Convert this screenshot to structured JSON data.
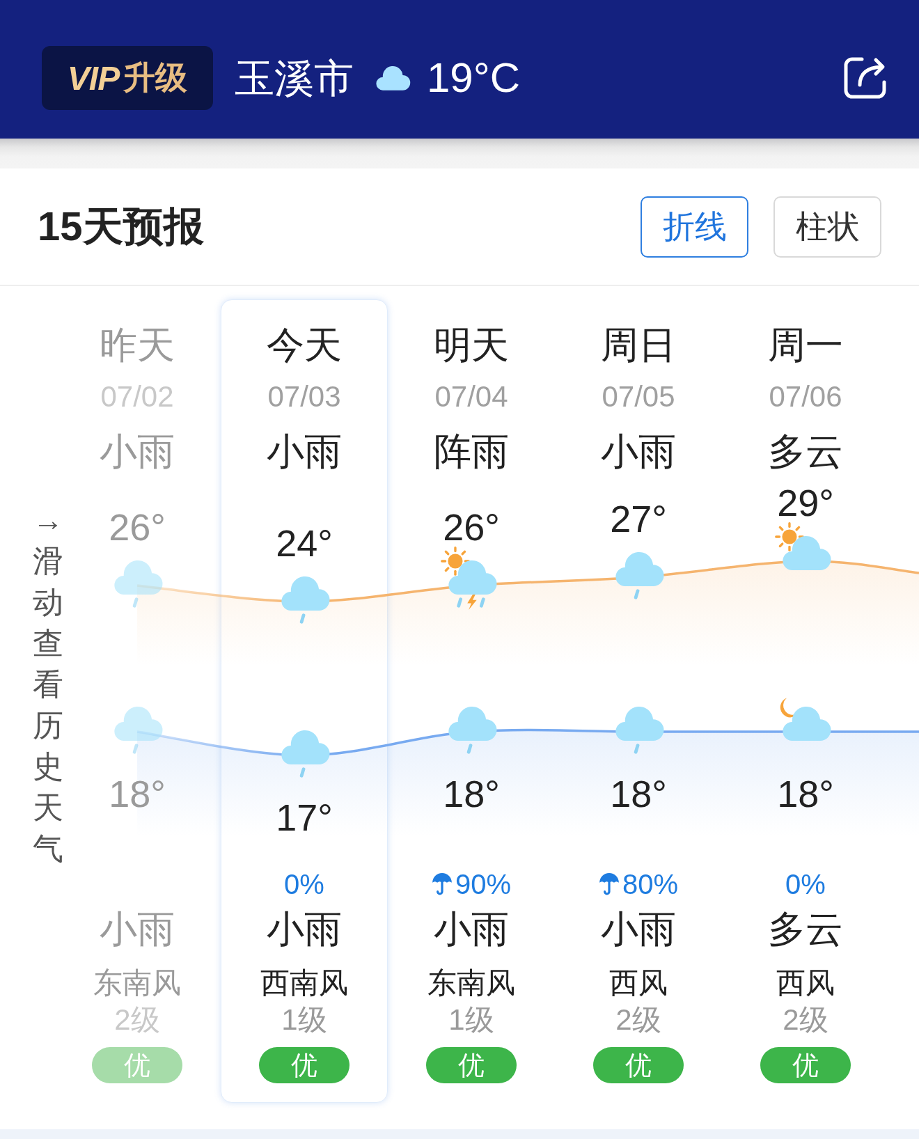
{
  "header": {
    "vip_button": {
      "badge": "VIP",
      "label": "升级"
    },
    "city": "玉溪市",
    "temperature": "19°C"
  },
  "forecast": {
    "title": "15天预报",
    "view_tabs": [
      {
        "label": "折线",
        "selected": true
      },
      {
        "label": "柱状",
        "selected": false
      }
    ],
    "history_hint": "→滑动查看历史天气",
    "days": [
      {
        "name": "昨天",
        "date": "07/02",
        "day_condition": "小雨",
        "high": "26°",
        "day_icon": {
          "kind": "rain"
        },
        "night_icon": {
          "kind": "rain"
        },
        "low": "18°",
        "night_condition": "小雨",
        "wind_direction": "东南风",
        "wind_level": "2级",
        "aqi": "优",
        "past": true,
        "selected": false
      },
      {
        "name": "今天",
        "date": "07/03",
        "day_condition": "小雨",
        "high": "24°",
        "day_icon": {
          "kind": "rain"
        },
        "night_icon": {
          "kind": "rain"
        },
        "low": "17°",
        "precipitation": {
          "text": "0%",
          "umbrella": false
        },
        "night_condition": "小雨",
        "wind_direction": "西南风",
        "wind_level": "1级",
        "aqi": "优",
        "past": false,
        "selected": true
      },
      {
        "name": "明天",
        "date": "07/04",
        "day_condition": "阵雨",
        "high": "26°",
        "day_icon": {
          "kind": "shower"
        },
        "night_icon": {
          "kind": "rain"
        },
        "low": "18°",
        "precipitation": {
          "text": "90%",
          "umbrella": true
        },
        "night_condition": "小雨",
        "wind_direction": "东南风",
        "wind_level": "1级",
        "aqi": "优",
        "past": false,
        "selected": false
      },
      {
        "name": "周日",
        "date": "07/05",
        "day_condition": "小雨",
        "high": "27°",
        "day_icon": {
          "kind": "rain"
        },
        "night_icon": {
          "kind": "rain"
        },
        "low": "18°",
        "precipitation": {
          "text": "80%",
          "umbrella": true
        },
        "night_condition": "小雨",
        "wind_direction": "西风",
        "wind_level": "2级",
        "aqi": "优",
        "past": false,
        "selected": false
      },
      {
        "name": "周一",
        "date": "07/06",
        "day_condition": "多云",
        "high": "29°",
        "day_icon": {
          "kind": "partly_cloudy"
        },
        "night_icon": {
          "kind": "partly_cloudy_night"
        },
        "low": "18°",
        "precipitation": {
          "text": "0%",
          "umbrella": false
        },
        "night_condition": "多云",
        "wind_direction": "西风",
        "wind_level": "2级",
        "aqi": "优",
        "past": false,
        "selected": false
      }
    ]
  }
}
